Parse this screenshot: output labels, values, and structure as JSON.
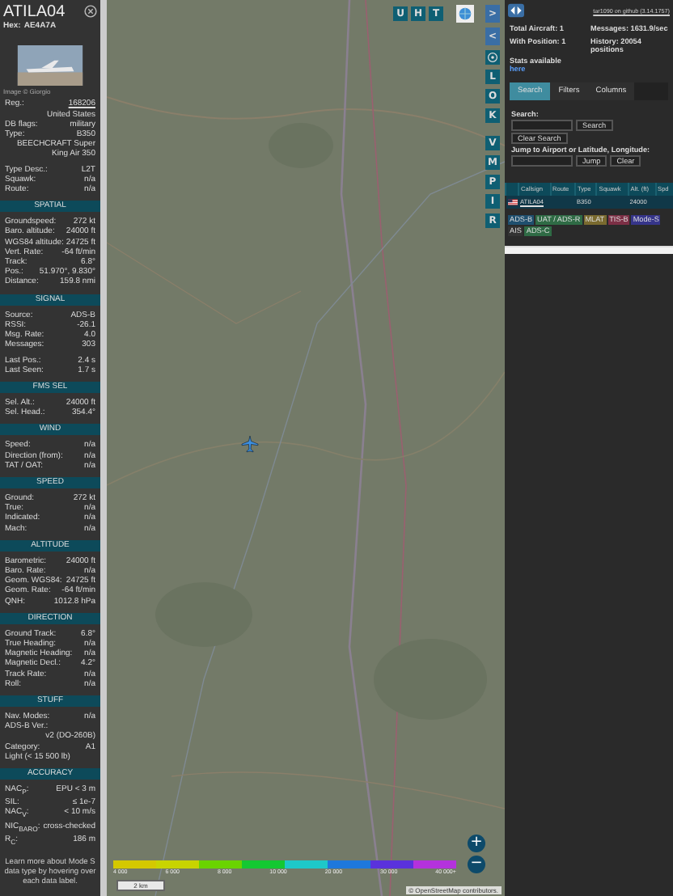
{
  "aircraft": {
    "callsign": "ATILA04",
    "hex_label": "Hex:",
    "hex": "AE4A7A",
    "photo_credit": "Image © Giorgio"
  },
  "details": [
    {
      "groups": [
        [
          {
            "label": "Reg.:",
            "value": "168206",
            "kind": "link"
          },
          {
            "value": "United States",
            "kind": "value"
          },
          {
            "label": "DB flags:",
            "value": "military",
            "kind": "pair"
          },
          {
            "label": "Type:",
            "value": "B350",
            "kind": "pair"
          },
          {
            "value": "BEECHCRAFT Super King Air 350",
            "kind": "value"
          }
        ],
        [
          {
            "label": "Type Desc.:",
            "value": "L2T",
            "kind": "pair"
          },
          {
            "label": "Squawk:",
            "value": "n/a",
            "kind": "pair"
          },
          {
            "label": "Route:",
            "value": "n/a",
            "kind": "pair"
          }
        ]
      ]
    },
    {
      "title": "SPATIAL",
      "groups": [
        [
          {
            "label": "Groundspeed:",
            "value": "272 kt",
            "kind": "pair"
          },
          {
            "label": "Baro. altitude:",
            "value": "24000 ft",
            "kind": "pair"
          },
          {
            "label": "WGS84 altitude:",
            "value": "24725 ft",
            "kind": "pair"
          },
          {
            "label": "Vert. Rate:",
            "value": "-64 ft/min",
            "kind": "pair"
          },
          {
            "label": "Track:",
            "value": "6.8°",
            "kind": "pair"
          },
          {
            "label": "Pos.:",
            "value": "51.970°, 9.830°",
            "kind": "pair"
          },
          {
            "label": "Distance:",
            "value": "159.8 nmi",
            "kind": "pair"
          }
        ]
      ]
    },
    {
      "title": "SIGNAL",
      "groups": [
        [
          {
            "label": "Source:",
            "value": "ADS-B",
            "kind": "pair"
          },
          {
            "label": "RSSI:",
            "value": "-26.1",
            "kind": "pair"
          },
          {
            "label": "Msg. Rate:",
            "value": "4.0",
            "kind": "pair"
          },
          {
            "label": "Messages:",
            "value": "303",
            "kind": "pair"
          }
        ],
        [
          {
            "label": "Last Pos.:",
            "value": "2.4 s",
            "kind": "pair"
          },
          {
            "label": "Last Seen:",
            "value": "1.7 s",
            "kind": "pair"
          }
        ]
      ]
    },
    {
      "title": "FMS SEL",
      "groups": [
        [
          {
            "label": "Sel. Alt.:",
            "value": "24000 ft",
            "kind": "pair"
          },
          {
            "label": "Sel. Head.:",
            "value": "354.4°",
            "kind": "pair"
          }
        ]
      ]
    },
    {
      "title": "WIND",
      "groups": [
        [
          {
            "label": "Speed:",
            "value": "n/a",
            "kind": "pair"
          },
          {
            "label": "Direction (from):",
            "value": "n/a",
            "kind": "pair"
          },
          {
            "label": "TAT / OAT:",
            "value": "n/a",
            "kind": "pair"
          }
        ]
      ]
    },
    {
      "title": "SPEED",
      "groups": [
        [
          {
            "label": "Ground:",
            "value": "272 kt",
            "kind": "pair"
          },
          {
            "label": "True:",
            "value": "n/a",
            "kind": "pair"
          },
          {
            "label": "Indicated:",
            "value": "n/a",
            "kind": "pair"
          },
          {
            "label": "Mach:",
            "value": "n/a",
            "kind": "pair"
          }
        ]
      ]
    },
    {
      "title": "ALTITUDE",
      "groups": [
        [
          {
            "label": "Barometric:",
            "value": "24000 ft",
            "kind": "pair"
          },
          {
            "label": "Baro. Rate:",
            "value": "n/a",
            "kind": "pair"
          },
          {
            "label": "Geom. WGS84:",
            "value": "24725 ft",
            "kind": "pair"
          },
          {
            "label": "Geom. Rate:",
            "value": "-64 ft/min",
            "kind": "pair"
          },
          {
            "label": "QNH:",
            "value": "1012.8 hPa",
            "kind": "pair"
          }
        ]
      ]
    },
    {
      "title": "DIRECTION",
      "groups": [
        [
          {
            "label": "Ground Track:",
            "value": "6.8°",
            "kind": "pair"
          },
          {
            "label": "True Heading:",
            "value": "n/a",
            "kind": "pair"
          },
          {
            "label": "Magnetic Heading:",
            "value": "n/a",
            "kind": "pair"
          },
          {
            "label": "Magnetic Decl.:",
            "value": "4.2°",
            "kind": "pair"
          },
          {
            "label": "Track Rate:",
            "value": "n/a",
            "kind": "pair"
          },
          {
            "label": "Roll:",
            "value": "n/a",
            "kind": "pair"
          }
        ]
      ]
    },
    {
      "title": "STUFF",
      "groups": [
        [
          {
            "label": "Nav. Modes:",
            "value": "n/a",
            "kind": "pair"
          },
          {
            "label": "ADS-B Ver.:",
            "value": "v2 (DO-260B)",
            "kind": "pair"
          },
          {
            "label": "Category:",
            "value": "A1",
            "kind": "pair"
          },
          {
            "label": "Light (< 15 500 lb)",
            "kind": "note"
          }
        ]
      ]
    },
    {
      "title": "ACCURACY",
      "groups": [
        [
          {
            "label": "NAC$_{P}$:",
            "value": "EPU < 3 m",
            "kind": "pair"
          },
          {
            "label": "SIL:",
            "value": "≤ 1e-7",
            "kind": "pair"
          },
          {
            "label": "NAC$_{V}$:",
            "value": "< 10 m/s",
            "kind": "pair"
          },
          {
            "label": "NIC$_{BARO}$:",
            "value": "cross-checked",
            "kind": "pair"
          },
          {
            "label": "R$_{C}$:",
            "value": "186 m",
            "kind": "pair"
          }
        ]
      ]
    }
  ],
  "footer_note": "Learn more about Mode S data type by hovering over each data label.",
  "map": {
    "top_buttons": [
      "U",
      "H",
      "T"
    ],
    "side_buttons": [
      ">",
      "<"
    ],
    "layer_buttons": [
      "L",
      "O",
      "K"
    ],
    "more_buttons": [
      "V",
      "M",
      "P",
      "I",
      "R"
    ],
    "zoom": [
      "+",
      "−"
    ],
    "legend_ticks": [
      "4 000",
      "6 000",
      "8 000",
      "10 000",
      "20 000",
      "30 000",
      "40 000+"
    ],
    "scale": "2 km",
    "attribution": "© OpenStreetMap contributors."
  },
  "stats": {
    "version_link": "tar1090 on github (3.14.1757)",
    "total": "Total Aircraft: 1",
    "messages": "Messages: 1631.9/sec",
    "with_position": "With Position: 1",
    "history": "History: 20054 positions",
    "stats_text": "Stats available",
    "stats_link": "here"
  },
  "tabs": [
    {
      "label": "Search",
      "selected": true
    },
    {
      "label": "Filters",
      "selected": false
    },
    {
      "label": "Columns",
      "selected": false
    }
  ],
  "search": {
    "label": "Search:",
    "button": "Search",
    "clear": "Clear Search",
    "jump_label": "Jump to Airport or Latitude, Longitude:",
    "jump": "Jump",
    "jump_clear": "Clear"
  },
  "table": {
    "columns": [
      "Callsign",
      "Route",
      "Type",
      "Squawk",
      "Alt. (ft)",
      "Spd"
    ],
    "rows": [
      {
        "callsign": "ATILA04",
        "type": "B350",
        "altitude": "24000",
        "selected": false
      }
    ]
  },
  "sources": [
    {
      "label": "ADS-B",
      "color": "#1f4f6e"
    },
    {
      "label": "UAT / ADS-R",
      "color": "#2f6b45"
    },
    {
      "label": "MLAT",
      "color": "#7a6a2f"
    },
    {
      "label": "TIS-B",
      "color": "#7c2f45"
    },
    {
      "label": "Mode-S",
      "color": "#36358a"
    },
    {
      "label": "AIS",
      "color": "#333333"
    },
    {
      "label": "ADS-C",
      "color": "#2f6b45"
    }
  ]
}
